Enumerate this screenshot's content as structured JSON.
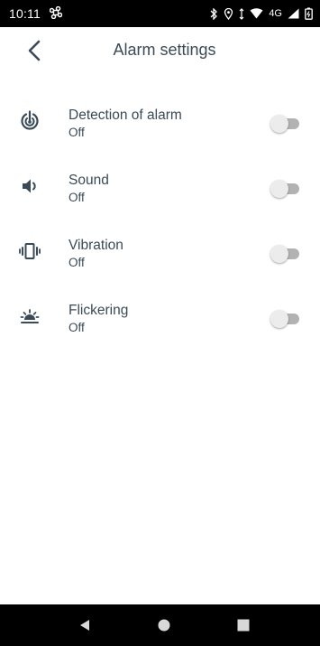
{
  "status_bar": {
    "time": "10:11",
    "network": "4G"
  },
  "header": {
    "title": "Alarm settings"
  },
  "settings": [
    {
      "label": "Detection of alarm",
      "value": "Off",
      "icon": "alarm-detection-icon",
      "enabled": false
    },
    {
      "label": "Sound",
      "value": "Off",
      "icon": "speaker-icon",
      "enabled": false
    },
    {
      "label": "Vibration",
      "value": "Off",
      "icon": "vibration-icon",
      "enabled": false
    },
    {
      "label": "Flickering",
      "value": "Off",
      "icon": "flicker-light-icon",
      "enabled": false
    }
  ],
  "colors": {
    "text": "#3a4a57",
    "toggle_track": "#b2b2b2",
    "toggle_thumb": "#ececec",
    "system_bars": "#000000"
  }
}
